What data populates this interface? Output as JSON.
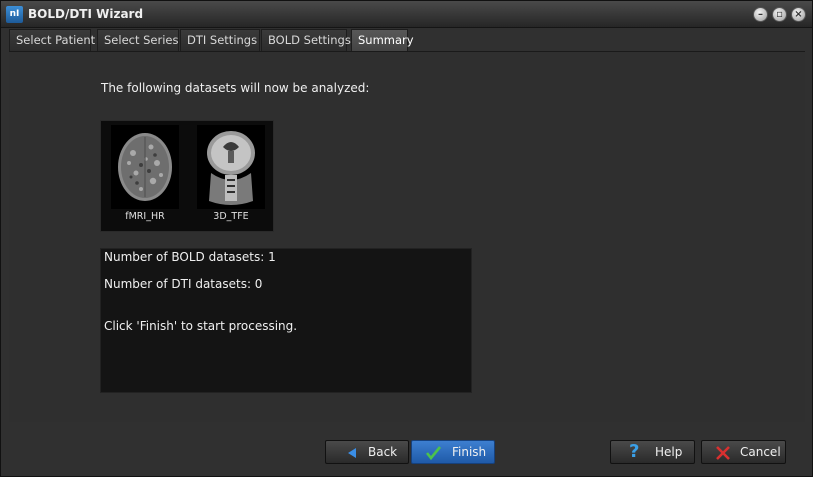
{
  "window": {
    "title": "BOLD/DTI Wizard",
    "icon": "nI"
  },
  "tabs": [
    {
      "label": "Select Patient"
    },
    {
      "label": "Select Series"
    },
    {
      "label": "DTI Settings"
    },
    {
      "label": "BOLD Settings"
    },
    {
      "label": "Summary",
      "active": true
    }
  ],
  "main": {
    "intro": "The following datasets will now be analyzed:",
    "datasets": [
      {
        "name": "fMRI_HR",
        "icon": "axial-brain-scan"
      },
      {
        "name": "3D_TFE",
        "icon": "coronal-brain-scan"
      }
    ],
    "summary": {
      "bold_count": "Number of BOLD datasets: 1",
      "dti_count": "Number of DTI datasets: 0",
      "instruction": "Click 'Finish' to start processing."
    }
  },
  "buttons": {
    "back": "Back",
    "finish": "Finish",
    "help": "Help",
    "cancel": "Cancel"
  },
  "colors": {
    "primary_button": "#2e6cc0",
    "back_arrow": "#3a8ee6",
    "finish_check": "#4cc24c",
    "help_question": "#3aa0e8",
    "cancel_x": "#d83030"
  }
}
